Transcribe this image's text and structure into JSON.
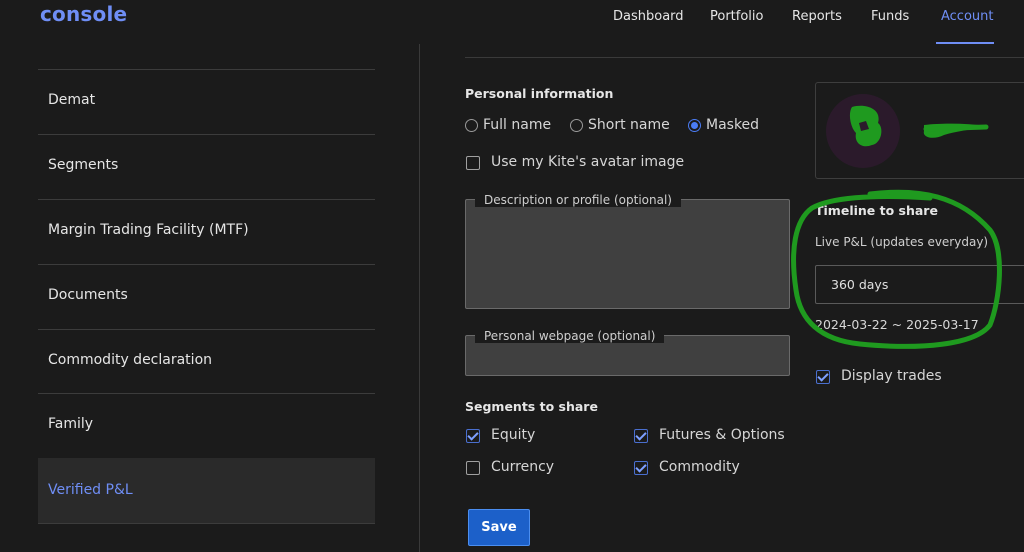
{
  "header": {
    "logo": "console",
    "nav": [
      "Dashboard",
      "Portfolio",
      "Reports",
      "Funds",
      "Account"
    ],
    "active_nav": "Account"
  },
  "sidebar": {
    "items": [
      {
        "label": "Demat"
      },
      {
        "label": "Segments"
      },
      {
        "label": "Margin Trading Facility (MTF)"
      },
      {
        "label": "Documents"
      },
      {
        "label": "Commodity declaration"
      },
      {
        "label": "Family"
      },
      {
        "label": "Verified P&L"
      }
    ],
    "active": "Verified P&L"
  },
  "personal": {
    "title": "Personal information",
    "name_options": [
      "Full name",
      "Short name",
      "Masked"
    ],
    "selected_name_option": "Masked",
    "avatar_checkbox": {
      "label": "Use my Kite's avatar image",
      "checked": false
    },
    "description_label": "Description or profile (optional)",
    "description_value": "",
    "webpage_label": "Personal webpage (optional)",
    "webpage_value": ""
  },
  "segments": {
    "title": "Segments to share",
    "items": [
      {
        "label": "Equity",
        "checked": true
      },
      {
        "label": "Futures & Options",
        "checked": true
      },
      {
        "label": "Currency",
        "checked": false
      },
      {
        "label": "Commodity",
        "checked": true
      }
    ]
  },
  "save_label": "Save",
  "timeline": {
    "title": "Timeline to share",
    "hint": "Live P&L (updates everyday)",
    "selected": "360 days",
    "range": "2024-03-22 ~ 2025-03-17"
  },
  "display_trades": {
    "label": "Display trades",
    "checked": true
  },
  "colors": {
    "accent": "#6f8ef5",
    "button": "#1c60c9",
    "annotation": "#1f9a1f"
  }
}
